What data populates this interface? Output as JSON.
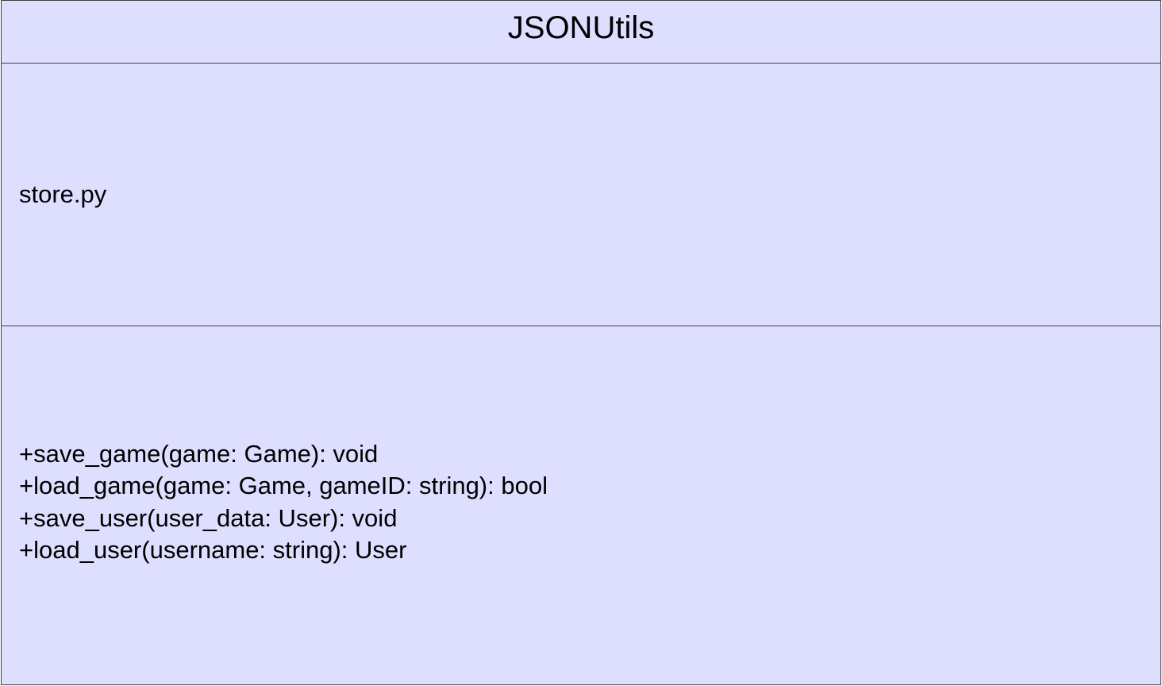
{
  "class_box": {
    "name": "JSONUtils",
    "attributes": [
      "store.py"
    ],
    "operations": [
      "+save_game(game: Game): void",
      "+load_game(game: Game, gameID: string): bool",
      "+save_user(user_data: User): void",
      "+load_user(username: string): User"
    ]
  },
  "colors": {
    "fill": "#dedeff",
    "border": "#404040",
    "text": "#000000"
  }
}
